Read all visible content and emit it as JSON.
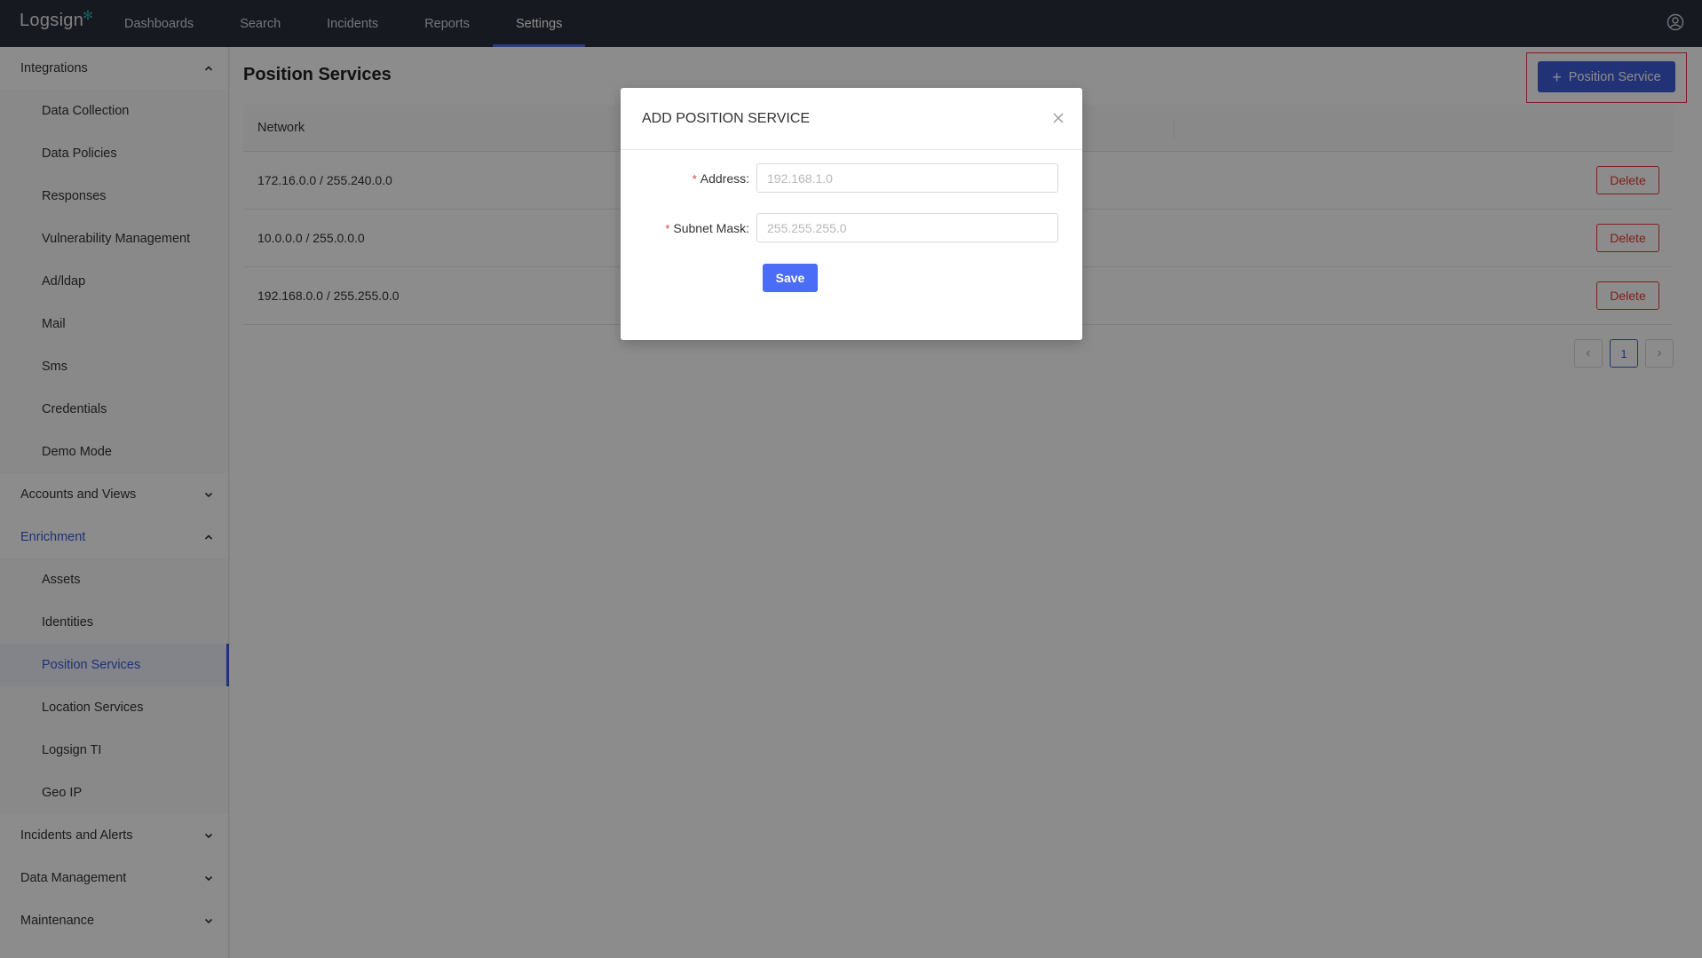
{
  "app": {
    "logo": "Logsign"
  },
  "nav": {
    "items": [
      {
        "label": "Dashboards"
      },
      {
        "label": "Search"
      },
      {
        "label": "Incidents"
      },
      {
        "label": "Reports"
      },
      {
        "label": "Settings"
      }
    ],
    "active": "Settings"
  },
  "sidebar": {
    "integrations": {
      "label": "Integrations",
      "items": [
        "Data Collection",
        "Data Policies",
        "Responses",
        "Vulnerability Management",
        "Ad/ldap",
        "Mail",
        "Sms",
        "Credentials",
        "Demo Mode"
      ]
    },
    "accounts": {
      "label": "Accounts and Views"
    },
    "enrichment": {
      "label": "Enrichment",
      "items": [
        "Assets",
        "Identities",
        "Position Services",
        "Location Services",
        "Logsign TI",
        "Geo IP"
      ]
    },
    "incidents_alerts": {
      "label": "Incidents and Alerts"
    },
    "data_management": {
      "label": "Data Management"
    },
    "maintenance": {
      "label": "Maintenance"
    }
  },
  "main": {
    "title": "Position Services",
    "add_button": "Position Service",
    "table": {
      "header": "Network",
      "rows": [
        "172.16.0.0 / 255.240.0.0",
        "10.0.0.0 / 255.0.0.0",
        "192.168.0.0 / 255.255.0.0"
      ],
      "delete_label": "Delete"
    },
    "pagination": {
      "current": "1"
    }
  },
  "modal": {
    "title": "ADD POSITION SERVICE",
    "address_label": "Address",
    "address_placeholder": "192.168.1.0",
    "subnet_label": "Subnet Mask",
    "subnet_placeholder": "255.255.255.0",
    "colon": ":",
    "required_mark": "*",
    "save_label": "Save"
  },
  "colors": {
    "accent": "#3e5bd8",
    "danger": "#e53935",
    "topbar": "#2b2f3d"
  }
}
